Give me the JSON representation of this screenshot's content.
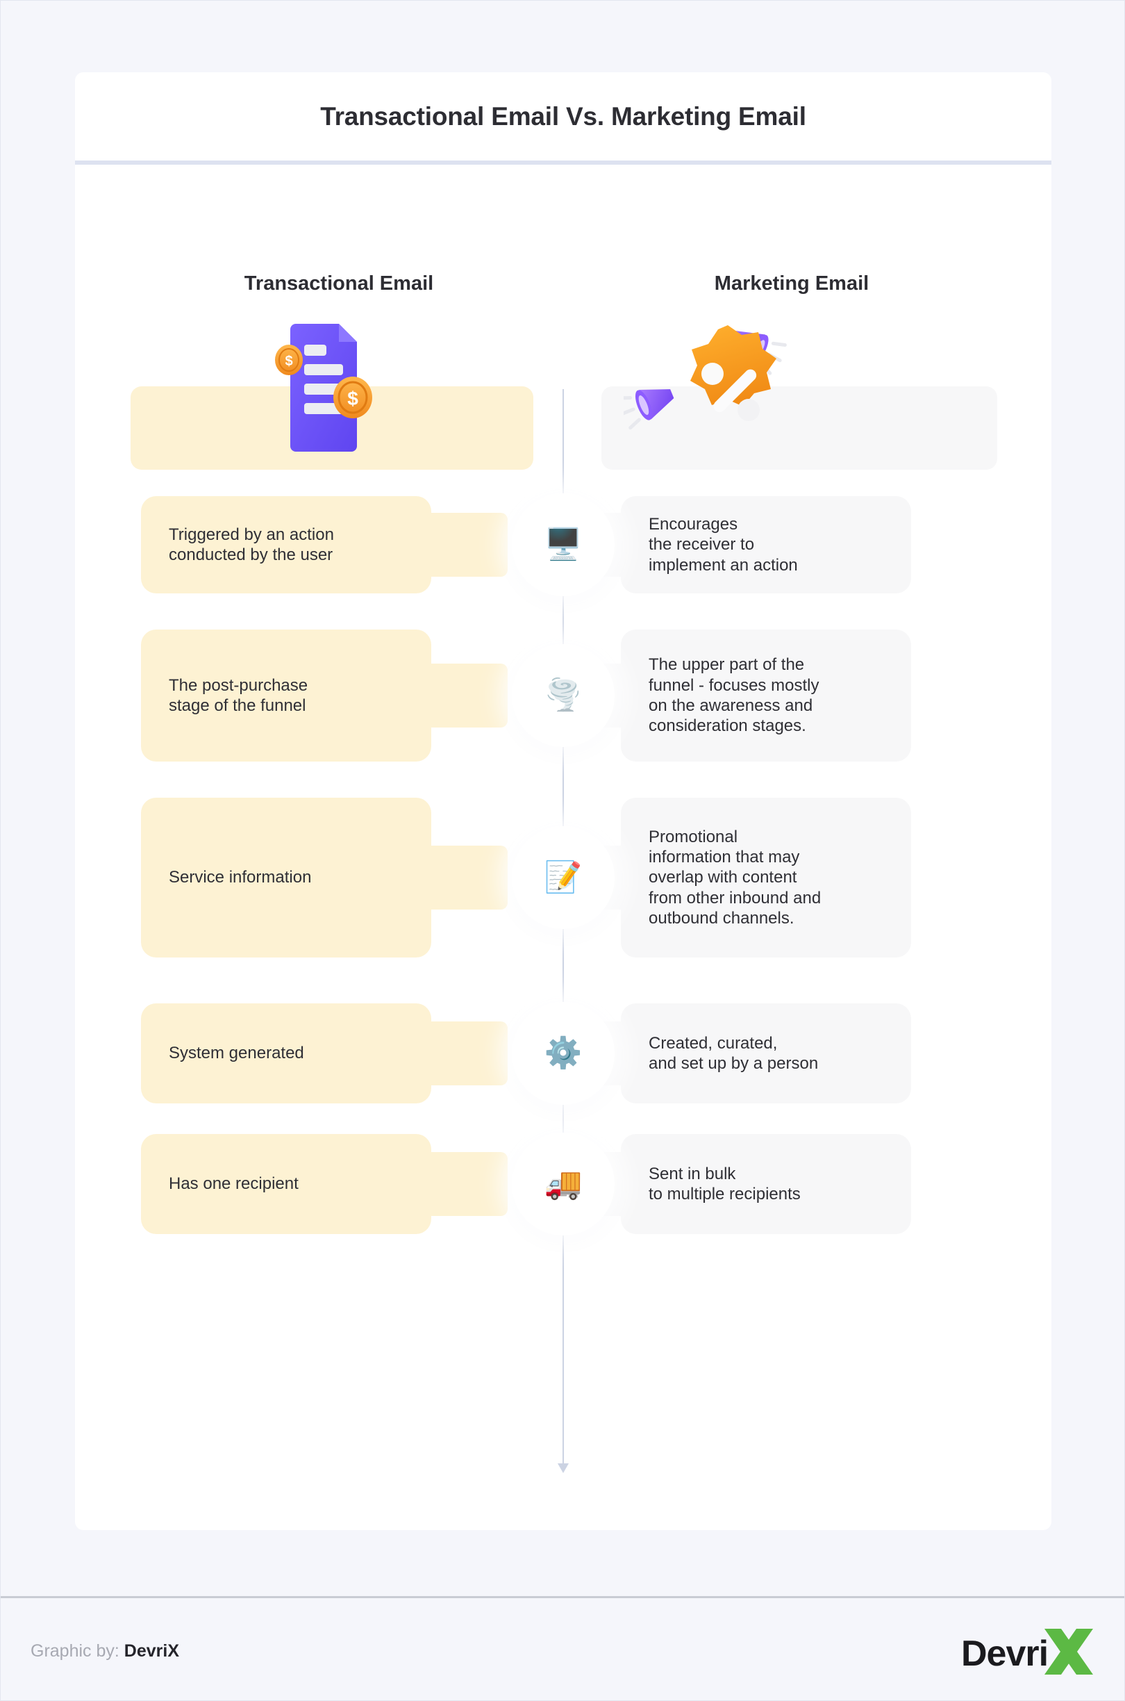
{
  "header": {
    "title": "Transactional Email Vs. Marketing Email"
  },
  "columns": {
    "left_label": "Transactional Email",
    "right_label": "Marketing Email"
  },
  "hero": {
    "left_icon": "invoice-document-with-coins-icon",
    "right_icon": "discount-badge-with-megaphones-icon"
  },
  "rows": [
    {
      "icon": "desktop-computer-icon",
      "icon_glyph": "🖥️",
      "left": "Triggered by an action\nconducted by the user",
      "right": "Encourages\nthe receiver to\nimplement an action"
    },
    {
      "icon": "funnel-tornado-icon",
      "icon_glyph": "🌪️",
      "left": "The post-purchase\nstage of the funnel",
      "right": "The upper part of the\nfunnel - focuses mostly\non the awareness and\nconsideration stages."
    },
    {
      "icon": "memo-pencil-icon",
      "icon_glyph": "📝",
      "left": "Service information",
      "right": "Promotional\ninformation that may\noverlap with content\nfrom other inbound and\noutbound channels."
    },
    {
      "icon": "gear-icon",
      "icon_glyph": "⚙️",
      "left": "System generated",
      "right": "Created, curated,\nand set up by a person"
    },
    {
      "icon": "delivery-truck-icon",
      "icon_glyph": "🚚",
      "left": "Has one recipient",
      "right": "Sent in bulk\nto multiple recipients"
    }
  ],
  "footer": {
    "credit_prefix": "Graphic by:",
    "credit_brand": "DevriX",
    "logo_word": "Devri",
    "logo_mark": "X"
  },
  "colors": {
    "page_background": "#f5f6fb",
    "card_background": "#ffffff",
    "left_card": "#fdf2d3",
    "right_card": "#f7f7f8",
    "divider": "#dde2f0",
    "timeline": "#ccd3e3",
    "title_text": "#2d2d33",
    "body_text": "#2f2f35",
    "logo_green": "#5cb944"
  }
}
